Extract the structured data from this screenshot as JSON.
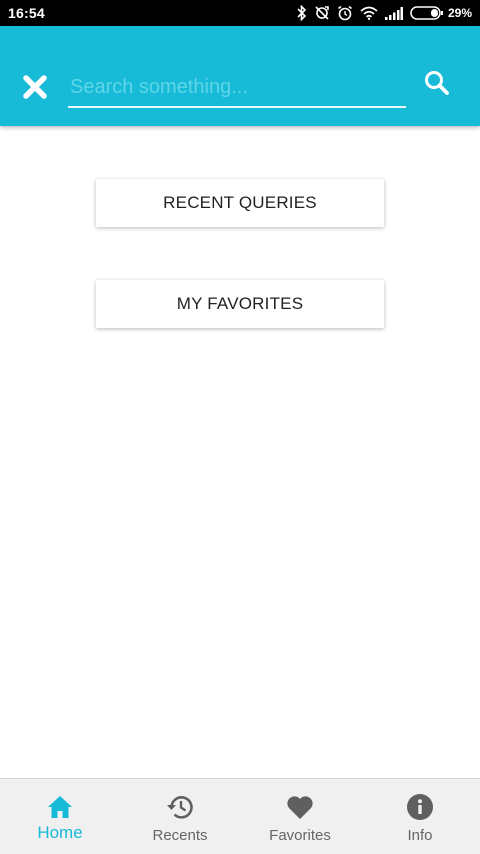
{
  "status_bar": {
    "time": "16:54",
    "battery_percent": "29%",
    "icons": [
      "bluetooth-icon",
      "no-sync-icon",
      "alarm-icon",
      "wifi-icon",
      "signal-icon",
      "battery-icon"
    ]
  },
  "toolbar": {
    "close_icon": "close-icon",
    "search_placeholder": "Search something...",
    "search_value": "",
    "search_icon": "search-icon",
    "background_color": "#17bbd7"
  },
  "main": {
    "recent_queries_label": "RECENT QUERIES",
    "my_favorites_label": "MY FAVORITES"
  },
  "bottom_nav": {
    "active_index": 0,
    "accent_color": "#17bbd7",
    "items": [
      {
        "label": "Home",
        "icon": "home-icon"
      },
      {
        "label": "Recents",
        "icon": "history-icon"
      },
      {
        "label": "Favorites",
        "icon": "heart-icon"
      },
      {
        "label": "Info",
        "icon": "info-icon"
      }
    ]
  }
}
